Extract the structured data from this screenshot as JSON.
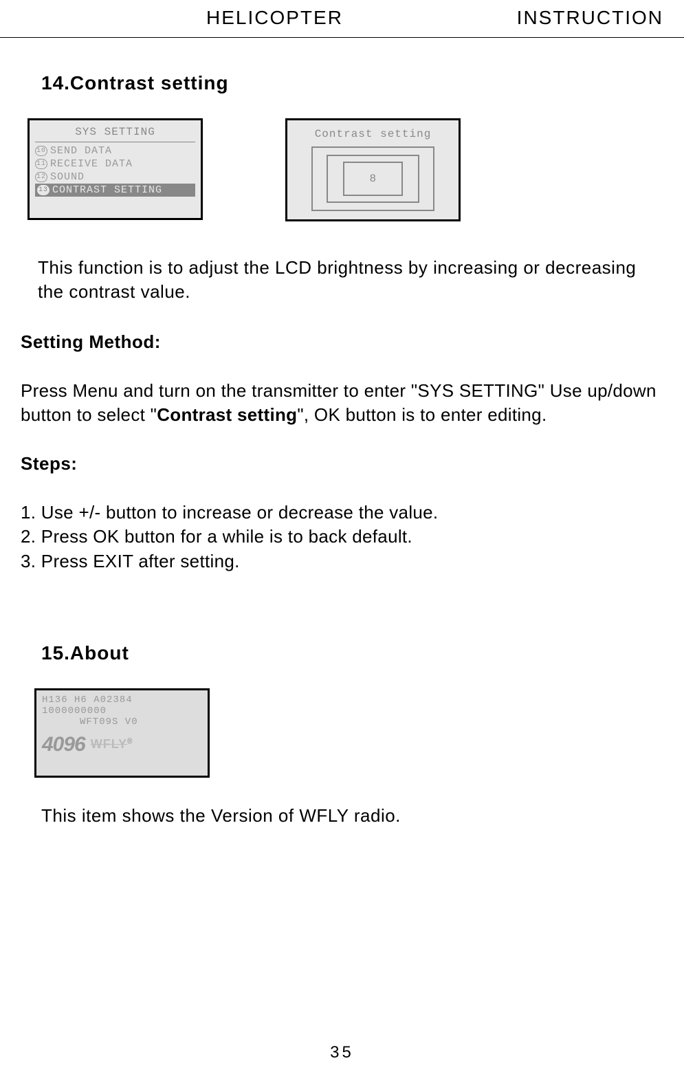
{
  "header": {
    "left": "HELICOPTER",
    "right": "INSTRUCTION"
  },
  "section14": {
    "title": "14.Contrast setting",
    "lcd_left": {
      "title": "SYS SETTING",
      "items": [
        {
          "num": "10",
          "label": "SEND DATA"
        },
        {
          "num": "11",
          "label": "RECEIVE DATA"
        },
        {
          "num": "12",
          "label": "SOUND"
        },
        {
          "num": "13",
          "label": "CONTRAST SETTING"
        }
      ]
    },
    "lcd_right": {
      "title": "Contrast setting",
      "value": "8"
    },
    "description": "This function is to adjust the LCD brightness by increasing or decreasing the contrast value.",
    "method_heading": "Setting Method:",
    "method_text_pre": "Press Menu and turn on the transmitter to enter \"SYS SETTING\" Use up/down button to select \"",
    "method_text_bold": "Contrast setting",
    "method_text_post": "\", OK button is to enter editing.",
    "steps_heading": "Steps:",
    "steps": [
      "1. Use +/- button to increase or decrease the value.",
      "2. Press OK button for a while is to back default.",
      "3. Press EXIT after setting."
    ]
  },
  "section15": {
    "title": "15.About",
    "lcd": {
      "line1": "H136 H6 A02384",
      "line2": "1000000000",
      "line3": "WFT09S V0",
      "logo_num": "4096",
      "logo_brand": "WFLY",
      "reg": "®"
    },
    "description": "This item shows the Version of WFLY radio."
  },
  "page_number": "35"
}
